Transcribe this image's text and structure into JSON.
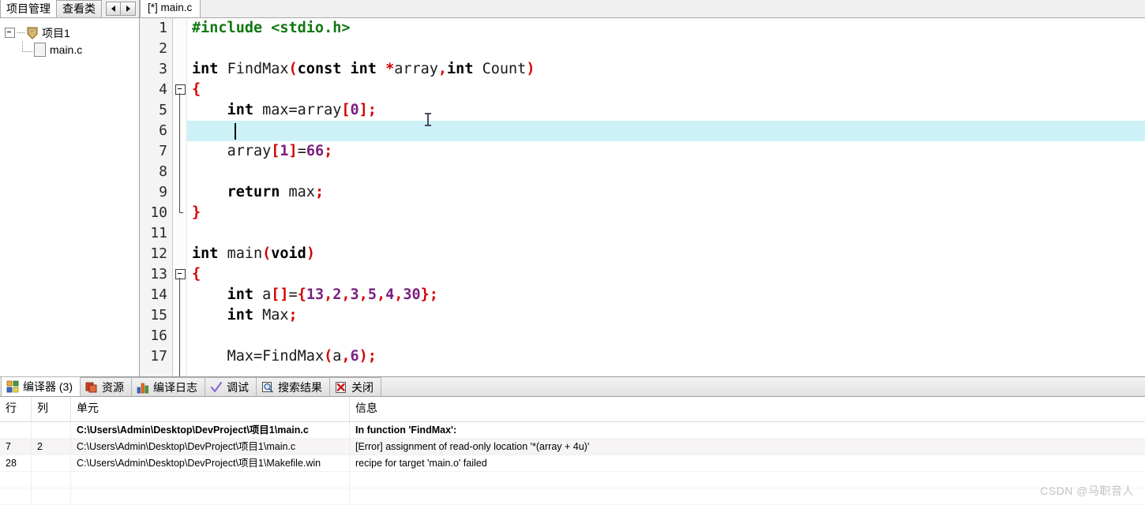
{
  "left_panel": {
    "tabs": [
      {
        "label": "项目管理",
        "active": true
      },
      {
        "label": "查看类",
        "active": false
      }
    ],
    "nav_prev": "◀",
    "nav_next": "▶",
    "tree": {
      "project": "项目1",
      "file": "main.c"
    }
  },
  "editor": {
    "tab_label": "[*] main.c",
    "highlight_line": 6,
    "line_numbers": [
      1,
      2,
      3,
      4,
      5,
      6,
      7,
      8,
      9,
      10,
      11,
      12,
      13,
      14,
      15,
      16,
      17
    ],
    "lines": [
      {
        "n": 1,
        "text": "#include <stdio.h>"
      },
      {
        "n": 2,
        "text": ""
      },
      {
        "n": 3,
        "text": "int FindMax(const int *array,int Count)"
      },
      {
        "n": 4,
        "text": "{"
      },
      {
        "n": 5,
        "text": "    int max=array[0];"
      },
      {
        "n": 6,
        "text": ""
      },
      {
        "n": 7,
        "text": "    array[1]=66;"
      },
      {
        "n": 8,
        "text": ""
      },
      {
        "n": 9,
        "text": "    return max;"
      },
      {
        "n": 10,
        "text": "}"
      },
      {
        "n": 11,
        "text": ""
      },
      {
        "n": 12,
        "text": "int main(void)"
      },
      {
        "n": 13,
        "text": "{"
      },
      {
        "n": 14,
        "text": "    int a[]={13,2,3,5,4,30};"
      },
      {
        "n": 15,
        "text": "    int Max;"
      },
      {
        "n": 16,
        "text": ""
      },
      {
        "n": 17,
        "text": "    Max=FindMax(a,6);"
      }
    ]
  },
  "bottom_panel": {
    "tabs": [
      {
        "label": "编译器 (3)",
        "icon": "grid-squares-icon",
        "active": true
      },
      {
        "label": "资源",
        "icon": "copy-pages-icon",
        "active": false
      },
      {
        "label": "编译日志",
        "icon": "bar-chart-icon",
        "active": false
      },
      {
        "label": "调试",
        "icon": "checkmark-icon",
        "active": false
      },
      {
        "label": "搜索结果",
        "icon": "magnifier-icon",
        "active": false
      },
      {
        "label": "关闭",
        "icon": "close-x-icon",
        "active": false
      }
    ],
    "grid": {
      "headers": [
        "行",
        "列",
        "单元",
        "信息"
      ],
      "rows": [
        {
          "row": "",
          "col": "",
          "unit": "C:\\Users\\Admin\\Desktop\\DevProject\\项目1\\main.c",
          "message": "In function 'FindMax':",
          "bold": true,
          "selected": false
        },
        {
          "row": "7",
          "col": "2",
          "unit": "C:\\Users\\Admin\\Desktop\\DevProject\\项目1\\main.c",
          "message": "[Error] assignment of read-only location '*(array + 4u)'",
          "bold": false,
          "selected": true
        },
        {
          "row": "28",
          "col": "",
          "unit": "C:\\Users\\Admin\\Desktop\\DevProject\\项目1\\Makefile.win",
          "message": "recipe for target 'main.o' failed",
          "bold": false,
          "selected": false
        }
      ]
    }
  },
  "watermark": "CSDN @马职音人",
  "colors": {
    "highlight_line": "#ccf2f8",
    "keyword": "#000000",
    "preprocessor": "#117711",
    "punctuation": "#d40000",
    "number": "#7a2080"
  }
}
